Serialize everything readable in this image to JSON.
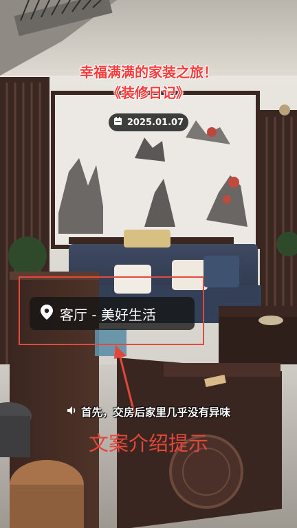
{
  "title": {
    "line1": "幸福满满的家装之旅！",
    "line2": "《装修日记》"
  },
  "date": {
    "icon": "calendar-icon",
    "text": "2025.01.07"
  },
  "location": {
    "icon": "location-pin-icon",
    "text": "客厅 - 美好生活"
  },
  "subtitle": {
    "icon": "speaker-icon",
    "text": "首先，交房后家里几乎没有异味"
  },
  "hint": {
    "text": "文案介绍提示"
  },
  "colors": {
    "accent_red": "#e2473a",
    "title_red": "#ff3b3b",
    "pill_bg": "#1e1e1e"
  }
}
